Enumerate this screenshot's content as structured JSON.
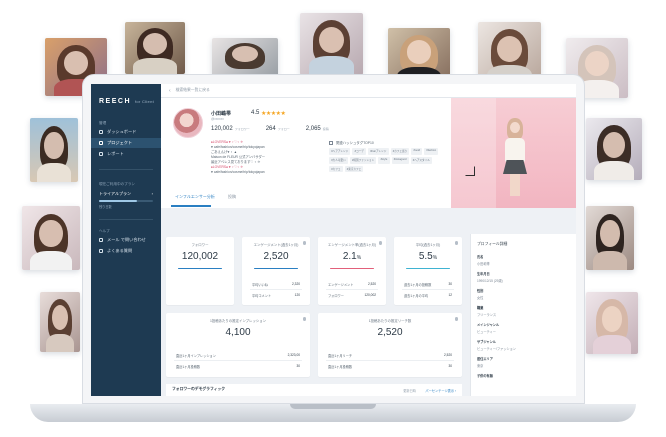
{
  "app": {
    "logo": "REECH",
    "logo_sub": "for Client"
  },
  "sidebar": {
    "section_label": "管理",
    "items": [
      {
        "label": "ダッシュボード",
        "icon": "dashboard-icon",
        "active": false
      },
      {
        "label": "プロジェクト",
        "icon": "project-icon",
        "active": true
      },
      {
        "label": "レポート",
        "icon": "report-icon",
        "active": false
      }
    ],
    "plan_label": "現在ご利用中のプラン",
    "plan_name": "トライアルプラン",
    "plan_arrow": "›",
    "plan_progress": 0.7,
    "plan_sub": "残り日数",
    "help_label": "ヘルプ",
    "help_items": [
      {
        "label": "メール で問い合わせ",
        "icon": "mail-icon"
      },
      {
        "label": "よくある質問",
        "icon": "faq-icon"
      }
    ]
  },
  "topbar": {
    "back": "‹",
    "breadcrumb": "検索結果一覧に戻る"
  },
  "profile": {
    "name": "小田嶋帯",
    "handle": "@xxxxxx",
    "score": "4.5",
    "stars": "★★★★★",
    "stats": [
      {
        "num": "120,002",
        "lbl": "フォロワー"
      },
      {
        "num": "264",
        "lbl": "フォロー"
      },
      {
        "num": "2,065",
        "lbl": "投稿"
      }
    ],
    "bio_lines": [
      "♠LOVERS♠ ♥ ♀♡♀ ✈",
      "♥ cafe/fashion/cosme/trip/tokyojapan",
      "ごあえんげ♥ ♀ ▲",
      "Maison de FLEUR 公式アンバサダー",
      "最近アベレス見ております♡ ♀ ✈",
      "♠LOVERS♠ ♥ ♀♡♀ ✈",
      "♥ cafe/fashion/cosme/trip/tokyojapan"
    ],
    "tags_title": "関連ハッシュタグTOP10",
    "tags": [
      "#ヘアアレンジ",
      "#コーデ",
      "#hairアレンジ",
      "#カフェ巡り",
      "#ootd",
      "#fashion",
      "#大人可愛い",
      "#韓国ファッション",
      "#style",
      "#instagood",
      "#ヘアスタイル",
      "#カフェ",
      "#東京カフェ"
    ]
  },
  "tabs": [
    {
      "label": "インフルエンサー分析",
      "active": true
    },
    {
      "label": "投稿",
      "active": false
    }
  ],
  "metrics_top": [
    {
      "title": "フォロワー",
      "value": "120,002",
      "unit": "",
      "bar_color": "#2a7fc2",
      "rows": [],
      "partial": false
    },
    {
      "title": "エンゲージメント(過去1ヶ月)",
      "value": "2,520",
      "unit": "",
      "bar_color": "#2a7fc2",
      "rows": [
        {
          "k": "平均いいね",
          "v": "2,320"
        },
        {
          "k": "平均コメント",
          "v": "120"
        }
      ]
    },
    {
      "title": "エンゲージメント率(過去1ヶ月)",
      "value": "2.1",
      "unit": "%",
      "bar_color": "#e2607a",
      "rows": [
        {
          "k": "エンゲージメント",
          "v": "2,520"
        },
        {
          "k": "フォロワー",
          "v": "120,002"
        }
      ]
    },
    {
      "title": "平均(過去1ヶ月)",
      "value": "5.5",
      "unit": "%",
      "bar_color": "#3fb3d2",
      "rows": [
        {
          "k": "過去1ヶ月の投稿数",
          "v": "30"
        },
        {
          "k": "過去1ヶ月の平均",
          "v": "12"
        }
      ]
    }
  ],
  "metrics_bottom": [
    {
      "title": "1投稿あたりの推定インプレッション",
      "value": "4,100",
      "rows": [
        {
          "k": "直近1ヶ月インプレッション",
          "v": "2,323,00"
        },
        {
          "k": "直近1ヶ月投稿数",
          "v": "30"
        }
      ]
    },
    {
      "title": "1投稿あたりの推定リーチ数",
      "value": "2,520",
      "rows": [
        {
          "k": "直近1ヶ月リーチ",
          "v": "2,520"
        },
        {
          "k": "直近1ヶ月投稿数",
          "v": "30"
        }
      ]
    }
  ],
  "profile_info": {
    "title": "プロフィール詳細",
    "fields": [
      {
        "k": "氏名",
        "v": "小田嶋帯"
      },
      {
        "k": "生年月日",
        "v": "1990/12/15 (29歳)"
      },
      {
        "k": "性別",
        "v": "女性"
      },
      {
        "k": "職業",
        "v": "フリーランス"
      },
      {
        "k": "メインジャンル",
        "v": "ビューティー"
      },
      {
        "k": "サブジャンル",
        "v": "ビューティー/ファッション"
      },
      {
        "k": "居住エリア",
        "v": "東京"
      },
      {
        "k": "子供の有無",
        "v": ""
      }
    ]
  },
  "demographics": {
    "title": "フォロワーのデモグラフィック",
    "meta": "更新日時",
    "link": "パーセンテージ表示 ›"
  },
  "colors": {
    "sidebar_bg": "#1e3a52",
    "accent": "#2a7fc2",
    "star": "#f5a623"
  }
}
